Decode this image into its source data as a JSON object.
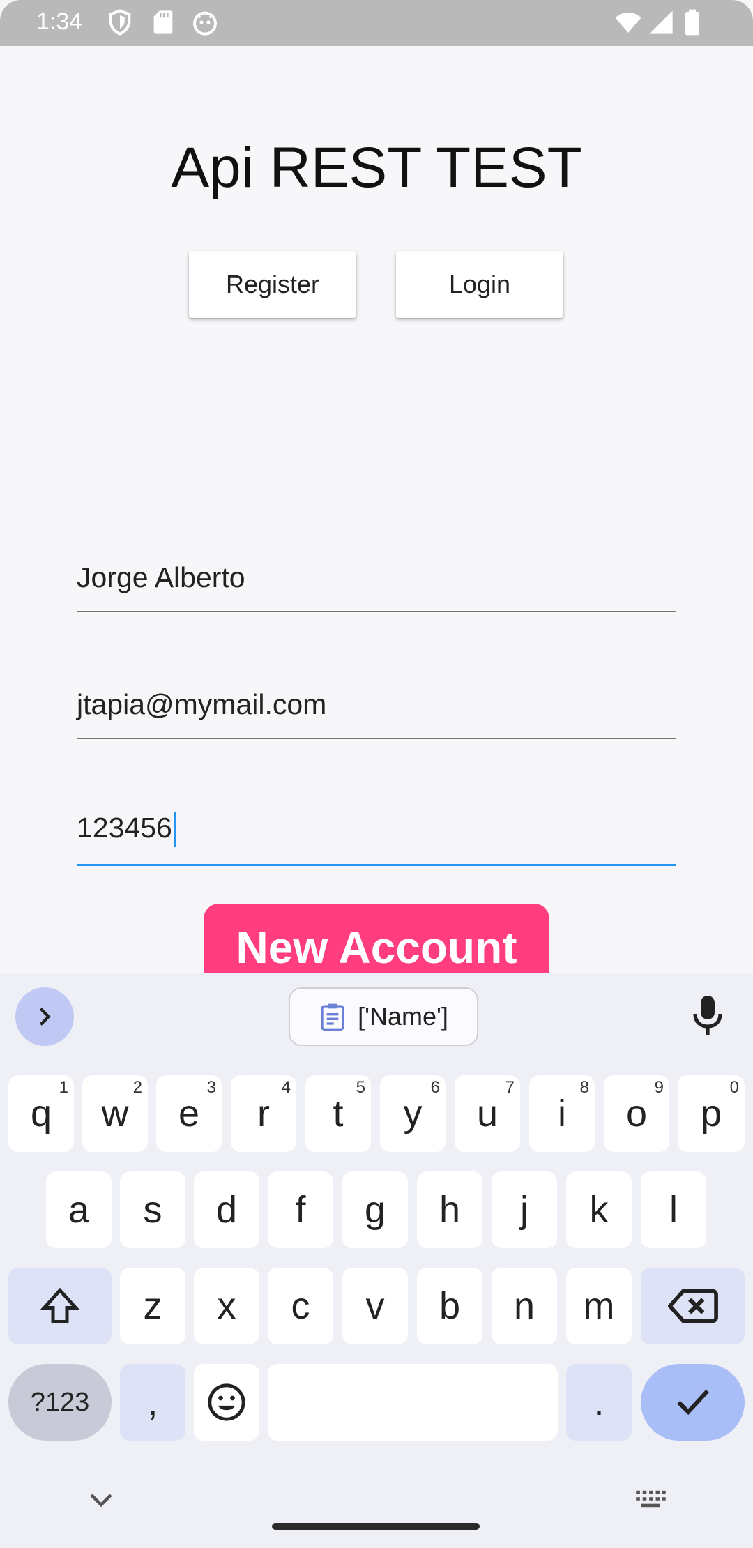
{
  "status_bar": {
    "time": "1:34",
    "icons": [
      "shield-icon",
      "sd-card-icon",
      "android-icon",
      "wifi-icon",
      "signal-icon",
      "battery-icon"
    ]
  },
  "app": {
    "title": "Api REST TEST",
    "register_label": "Register",
    "login_label": "Login",
    "name_value": "Jorge Alberto",
    "email_value": "jtapia@mymail.com",
    "password_value": "123456",
    "new_account_label": "New Account",
    "accent_color": "#ff3d7f",
    "focus_color": "#2196f3"
  },
  "keyboard": {
    "suggestion": "['Name']",
    "row1": [
      {
        "key": "q",
        "hint": "1"
      },
      {
        "key": "w",
        "hint": "2"
      },
      {
        "key": "e",
        "hint": "3"
      },
      {
        "key": "r",
        "hint": "4"
      },
      {
        "key": "t",
        "hint": "5"
      },
      {
        "key": "y",
        "hint": "6"
      },
      {
        "key": "u",
        "hint": "7"
      },
      {
        "key": "i",
        "hint": "8"
      },
      {
        "key": "o",
        "hint": "9"
      },
      {
        "key": "p",
        "hint": "0"
      }
    ],
    "row2": [
      "a",
      "s",
      "d",
      "f",
      "g",
      "h",
      "j",
      "k",
      "l"
    ],
    "row3": [
      "z",
      "x",
      "c",
      "v",
      "b",
      "n",
      "m"
    ],
    "symbols_label": "?123",
    "comma": ",",
    "period": "."
  }
}
